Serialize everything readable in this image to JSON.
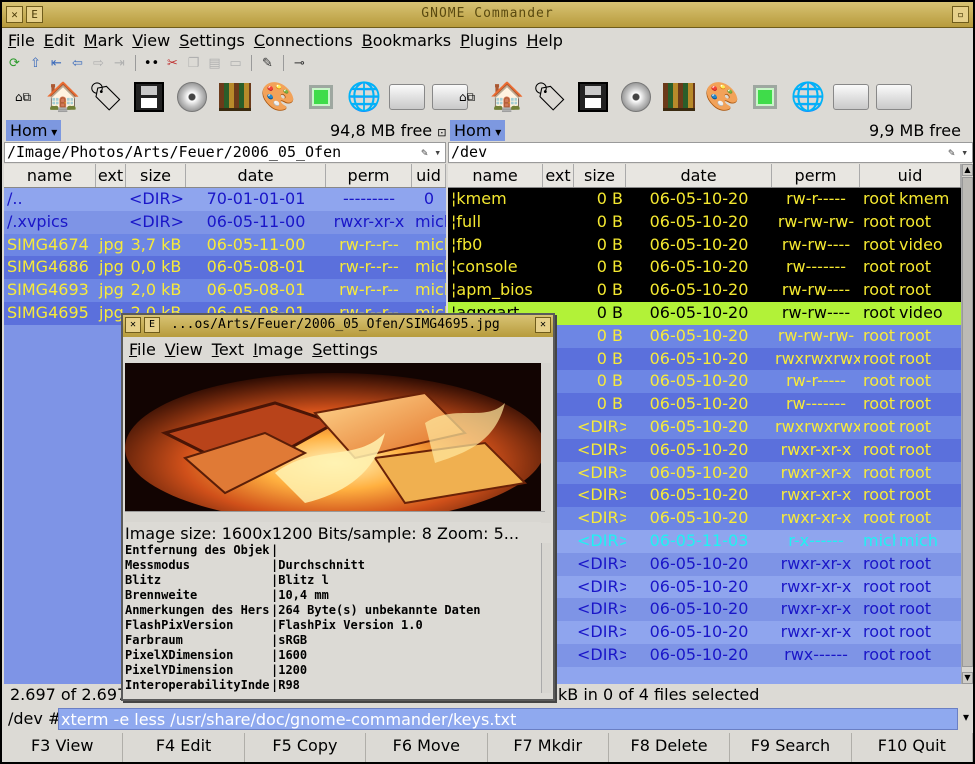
{
  "window": {
    "title": "GNOME Commander"
  },
  "menu": [
    "File",
    "Edit",
    "Mark",
    "View",
    "Settings",
    "Connections",
    "Bookmarks",
    "Plugins",
    "Help"
  ],
  "toolbar_icons": [
    "refresh-icon",
    "up-icon",
    "back-first-icon",
    "back-icon",
    "forward-icon",
    "forward-last-icon",
    "select-icon",
    "cut-icon",
    "copy-icon",
    "paste-icon",
    "delete-icon",
    "edit-icon",
    "ftp-icon"
  ],
  "left": {
    "device": "Hom",
    "free": "94,8 MB free",
    "path": "/Image/Photos/Arts/Feuer/2006_05_Ofen",
    "columns": [
      "name",
      "ext",
      "size",
      "date",
      "perm",
      "uid"
    ],
    "rows": [
      {
        "name": "/..",
        "ext": "",
        "size": "<DIR>",
        "date": "70-01-01-01",
        "perm": "---------",
        "uid": "0",
        "style": "lb1"
      },
      {
        "name": "/.xvpics",
        "ext": "",
        "size": "<DIR>",
        "date": "06-05-11-00",
        "perm": "rwxr-xr-x",
        "uid": "mich",
        "style": "lb2"
      },
      {
        "name": "SIMG4674",
        "ext": "jpg",
        "size": "3,7 kB",
        "date": "06-05-11-00",
        "perm": "rw-r--r--",
        "uid": "mich",
        "style": "blue1"
      },
      {
        "name": "SIMG4686",
        "ext": "jpg",
        "size": "0,0 kB",
        "date": "06-05-08-01",
        "perm": "rw-r--r--",
        "uid": "mich",
        "style": "blue2"
      },
      {
        "name": "SIMG4693",
        "ext": "jpg",
        "size": "2,0 kB",
        "date": "06-05-08-01",
        "perm": "rw-r--r--",
        "uid": "mich",
        "style": "blue1"
      },
      {
        "name": "SIMG4695",
        "ext": "jpg",
        "size": "2,0 kB",
        "date": "06-05-08-01",
        "perm": "rw-r--r--",
        "uid": "mich",
        "style": "blue2"
      }
    ],
    "status": "2.697 of 2.697"
  },
  "right": {
    "device": "Hom",
    "free": "9,9 MB free",
    "path": "/dev",
    "columns": [
      "name",
      "ext",
      "size",
      "date",
      "perm",
      "uid"
    ],
    "rows": [
      {
        "name": "kmem",
        "size": "0 B",
        "date": "06-05-10-20",
        "perm": "rw-r-----",
        "uid": "root",
        "gid": "kmem",
        "style": "blk"
      },
      {
        "name": "full",
        "size": "0 B",
        "date": "06-05-10-20",
        "perm": "rw-rw-rw-",
        "uid": "root",
        "gid": "root",
        "style": "blk"
      },
      {
        "name": "fb0",
        "size": "0 B",
        "date": "06-05-10-20",
        "perm": "rw-rw----",
        "uid": "root",
        "gid": "video",
        "style": "blk"
      },
      {
        "name": "console",
        "size": "0 B",
        "date": "06-05-10-20",
        "perm": "rw-------",
        "uid": "root",
        "gid": "root",
        "style": "blk"
      },
      {
        "name": "apm_bios",
        "size": "0 B",
        "date": "06-05-10-20",
        "perm": "rw-rw----",
        "uid": "root",
        "gid": "root",
        "style": "blk"
      },
      {
        "name": "agpgart",
        "size": "0 B",
        "date": "06-05-10-20",
        "perm": "rw-rw----",
        "uid": "root",
        "gid": "video",
        "style": "sel"
      },
      {
        "name": "",
        "size": "0 B",
        "date": "06-05-10-20",
        "perm": "rw-rw-rw-",
        "uid": "root",
        "gid": "root",
        "style": "blue1"
      },
      {
        "name": "",
        "size": "0 B",
        "date": "06-05-10-20",
        "perm": "rwxrwxrwx",
        "uid": "root",
        "gid": "root",
        "style": "blue2"
      },
      {
        "name": "",
        "size": "0 B",
        "date": "06-05-10-20",
        "perm": "rw-r-----",
        "uid": "root",
        "gid": "root",
        "style": "blue1"
      },
      {
        "name": "",
        "size": "0 B",
        "date": "06-05-10-20",
        "perm": "rw-------",
        "uid": "root",
        "gid": "root",
        "style": "blue2"
      },
      {
        "name": "",
        "size": "<DIR>",
        "date": "06-05-10-20",
        "perm": "rwxrwxrwx",
        "uid": "root",
        "gid": "root",
        "style": "blue1"
      },
      {
        "name": "",
        "size": "<DIR>",
        "date": "06-05-10-20",
        "perm": "rwxr-xr-x",
        "uid": "root",
        "gid": "root",
        "style": "blue2"
      },
      {
        "name": "",
        "size": "<DIR>",
        "date": "06-05-10-20",
        "perm": "rwxr-xr-x",
        "uid": "root",
        "gid": "root",
        "style": "blue1"
      },
      {
        "name": "",
        "size": "<DIR>",
        "date": "06-05-10-20",
        "perm": "rwxr-xr-x",
        "uid": "root",
        "gid": "root",
        "style": "blue2"
      },
      {
        "name": "",
        "size": "<DIR>",
        "date": "06-05-10-20",
        "perm": "rwxr-xr-x",
        "uid": "root",
        "gid": "root",
        "style": "blue1"
      },
      {
        "name": "",
        "size": "<DIR>",
        "date": "06-05-11-03",
        "perm": "r-x------",
        "uid": "mich",
        "gid": "mich",
        "style": "cyan"
      },
      {
        "name": "",
        "size": "<DIR>",
        "date": "06-05-10-20",
        "perm": "rwxr-xr-x",
        "uid": "root",
        "gid": "root",
        "style": "lb2"
      },
      {
        "name": "",
        "size": "<DIR>",
        "date": "06-05-10-20",
        "perm": "rwxr-xr-x",
        "uid": "root",
        "gid": "root",
        "style": "lb1"
      },
      {
        "name": "",
        "size": "<DIR>",
        "date": "06-05-10-20",
        "perm": "rwxr-xr-x",
        "uid": "root",
        "gid": "root",
        "style": "lb2"
      },
      {
        "name": "",
        "size": "<DIR>",
        "date": "06-05-10-20",
        "perm": "rwxr-xr-x",
        "uid": "root",
        "gid": "root",
        "style": "lb1"
      },
      {
        "name": "",
        "size": "<DIR>",
        "date": "06-05-10-20",
        "perm": "rwx------",
        "uid": "root",
        "gid": "root",
        "style": "lb2"
      }
    ],
    "status": "kB in 0 of 4 files selected"
  },
  "cmd": {
    "prompt": "/dev #",
    "value": "xterm -e less /usr/share/doc/gnome-commander/keys.txt"
  },
  "fkeys": [
    "F3 View",
    "F4 Edit",
    "F5 Copy",
    "F6 Move",
    "F7 Mkdir",
    "F8 Delete",
    "F9 Search",
    "F10 Quit"
  ],
  "viewer": {
    "title": "...os/Arts/Feuer/2006_05_Ofen/SIMG4695.jpg",
    "menu": [
      "File",
      "View",
      "Text",
      "Image",
      "Settings"
    ],
    "info": "Image size: 1600x1200     Bits/sample: 8     Zoom: 5...",
    "exif": [
      {
        "k": "Entfernung des Objek",
        "v": "|"
      },
      {
        "k": "Messmodus",
        "v": "|Durchschnitt"
      },
      {
        "k": "Blitz",
        "v": "|Blitz l"
      },
      {
        "k": "Brennweite",
        "v": "|10,4 mm"
      },
      {
        "k": "Anmerkungen des Hers",
        "v": "|264 Byte(s) unbekannte Daten"
      },
      {
        "k": "FlashPixVersion",
        "v": "|FlashPix Version 1.0"
      },
      {
        "k": "Farbraum",
        "v": "|sRGB"
      },
      {
        "k": "PixelXDimension",
        "v": "|1600"
      },
      {
        "k": "PixelYDimension",
        "v": "|1200"
      },
      {
        "k": "InteroperabilityInde",
        "v": "|R98"
      }
    ]
  }
}
